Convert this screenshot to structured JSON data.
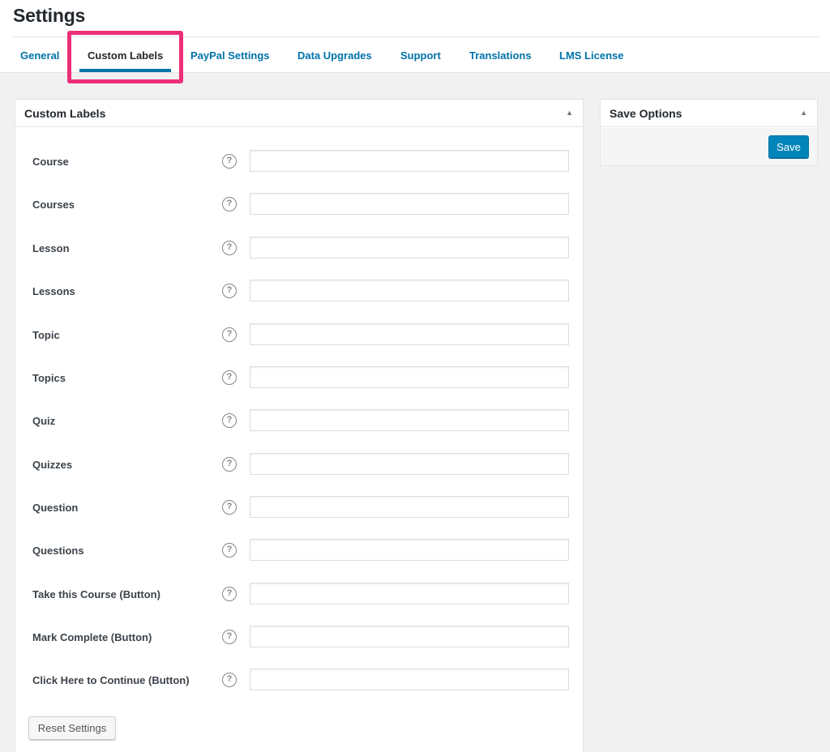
{
  "page": {
    "title": "Settings"
  },
  "tabs": [
    {
      "label": "General",
      "active": false
    },
    {
      "label": "Custom Labels",
      "active": true
    },
    {
      "label": "PayPal Settings",
      "active": false
    },
    {
      "label": "Data Upgrades",
      "active": false
    },
    {
      "label": "Support",
      "active": false
    },
    {
      "label": "Translations",
      "active": false
    },
    {
      "label": "LMS License",
      "active": false
    }
  ],
  "custom_labels": {
    "title": "Custom Labels",
    "help_glyph": "?",
    "fields": [
      {
        "label": "Course",
        "value": ""
      },
      {
        "label": "Courses",
        "value": ""
      },
      {
        "label": "Lesson",
        "value": ""
      },
      {
        "label": "Lessons",
        "value": ""
      },
      {
        "label": "Topic",
        "value": ""
      },
      {
        "label": "Topics",
        "value": ""
      },
      {
        "label": "Quiz",
        "value": ""
      },
      {
        "label": "Quizzes",
        "value": ""
      },
      {
        "label": "Question",
        "value": ""
      },
      {
        "label": "Questions",
        "value": ""
      },
      {
        "label": "Take this Course (Button)",
        "value": ""
      },
      {
        "label": "Mark Complete (Button)",
        "value": ""
      },
      {
        "label": "Click Here to Continue (Button)",
        "value": ""
      }
    ],
    "reset_label": "Reset Settings"
  },
  "save_options": {
    "title": "Save Options",
    "save_label": "Save"
  },
  "icons": {
    "collapse": "triangle-up-icon",
    "help": "question-circle-icon"
  },
  "colors": {
    "link": "#0073aa",
    "primary_button": "#0085ba",
    "highlight": "#ec2f78"
  }
}
